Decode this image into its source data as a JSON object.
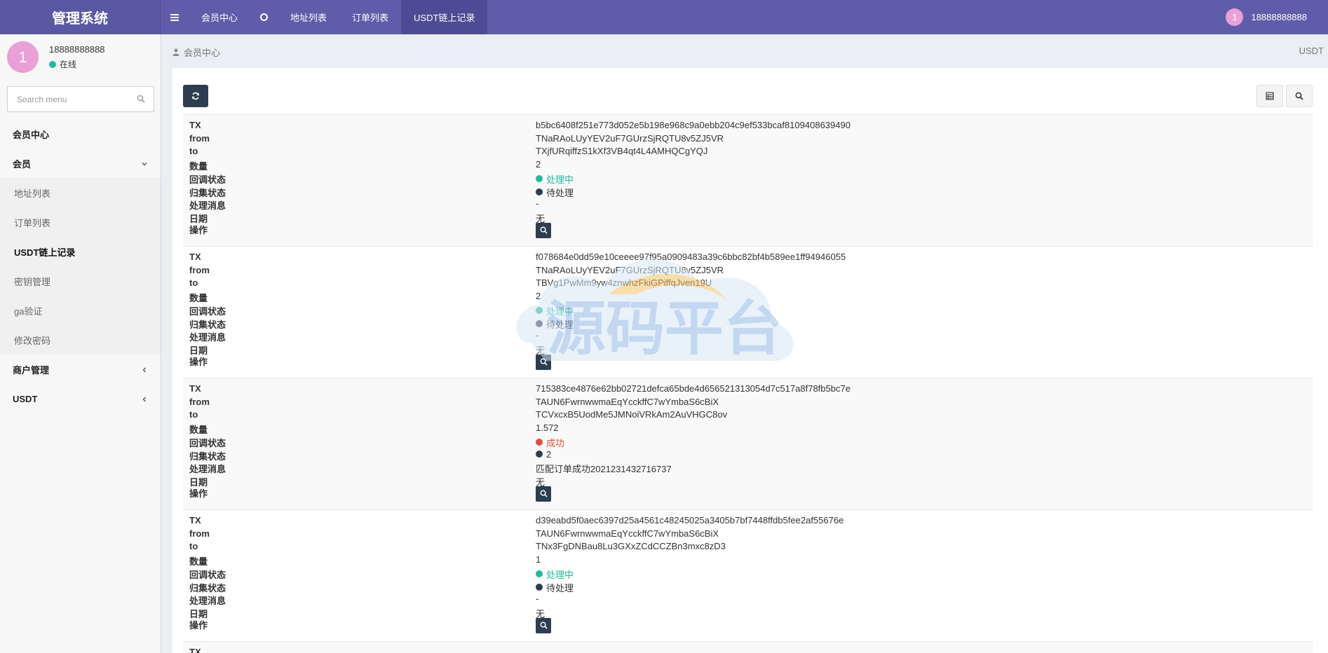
{
  "app": {
    "title": "管理系统"
  },
  "topnav": {
    "items": [
      {
        "label": "会员中心"
      },
      {
        "label": "地址列表"
      },
      {
        "label": "订单列表"
      },
      {
        "label": "USDT链上记录"
      }
    ],
    "user": {
      "avatar_initial": "1",
      "name": "18888888888"
    }
  },
  "sidebar": {
    "user": {
      "avatar_initial": "1",
      "name": "18888888888",
      "status": "在线"
    },
    "search": {
      "placeholder": "Search menu"
    },
    "menu": {
      "member_center": "会员中心",
      "member": "会员",
      "sub": [
        "地址列表",
        "订单列表",
        "USDT链上记录",
        "密钥管理",
        "ga验证",
        "修改密码"
      ],
      "active_sub": "USDT链上记录",
      "merchant": "商户管理",
      "usdt": "USDT"
    }
  },
  "breadcrumb": {
    "label": "会员中心",
    "right": "USDT"
  },
  "field_labels": [
    "TX",
    "from",
    "to",
    "数量",
    "回调状态",
    "归集状态",
    "处理消息",
    "日期",
    "操作"
  ],
  "records": [
    {
      "tx": "b5bc6408f251e773d052e5b198e968c9a0ebb204c9ef533bcaf8109408639490",
      "from": "TNaRAoLUyYEV2uF7GUrzSjRQTU8v5ZJ5VR",
      "to": "TXjfURqiffzS1kXf3VB4qt4L4AMHQCgYQJ",
      "amount": "2",
      "callback_status": "处理中",
      "callback_color": "#1bbc9b",
      "collect_status": "待处理",
      "collect_color": "#2c3e50",
      "message": "-",
      "date": "无"
    },
    {
      "tx": "f078684e0dd59e10ceeee97f95a0909483a39c6bbc82bf4b589ee1ff94946055",
      "from": "TNaRAoLUyYEV2uF7GUrzSjRQTU8v5ZJ5VR",
      "to": "TBVg1PwMm9yw4znwhzFkiGPiffqJven19U",
      "amount": "2",
      "callback_status": "处理中",
      "callback_color": "#1bbc9b",
      "collect_status": "待处理",
      "collect_color": "#2c3e50",
      "message": "-",
      "date": "无"
    },
    {
      "tx": "715383ce4876e62bb02721defca65bde4d656521313054d7c517a8f78fb5bc7e",
      "from": "TAUN6FwrnwwmaEqYcckffC7wYmbaS6cBiX",
      "to": "TCVxcxB5UodMe5JMNoiVRkAm2AuVHGC8ov",
      "amount": "1.572",
      "callback_status": "成功",
      "callback_color": "#e74c3c",
      "collect_status": "2",
      "collect_color": "#2c3e50",
      "message": "匹配订单成功2021231432716737",
      "date": "无"
    },
    {
      "tx": "d39eabd5f0aec6397d25a4561c48245025a3405b7bf7448ffdb5fee2af55676e",
      "from": "TAUN6FwrnwwmaEqYcckffC7wYmbaS6cBiX",
      "to": "TNx3FgDNBau8Lu3GXxZCdCCZBn3mxc8zD3",
      "amount": "1",
      "callback_status": "处理中",
      "callback_color": "#1bbc9b",
      "collect_status": "待处理",
      "collect_color": "#2c3e50",
      "message": "-",
      "date": "无"
    }
  ],
  "partial_record": {
    "tx_label": "TX"
  },
  "colors": {
    "header": "#5f5ca9",
    "dark_button": "#2c3e50",
    "success_green": "#1bbc9b",
    "danger_red": "#e74c3c"
  },
  "watermark": {
    "text": "源码平台"
  }
}
